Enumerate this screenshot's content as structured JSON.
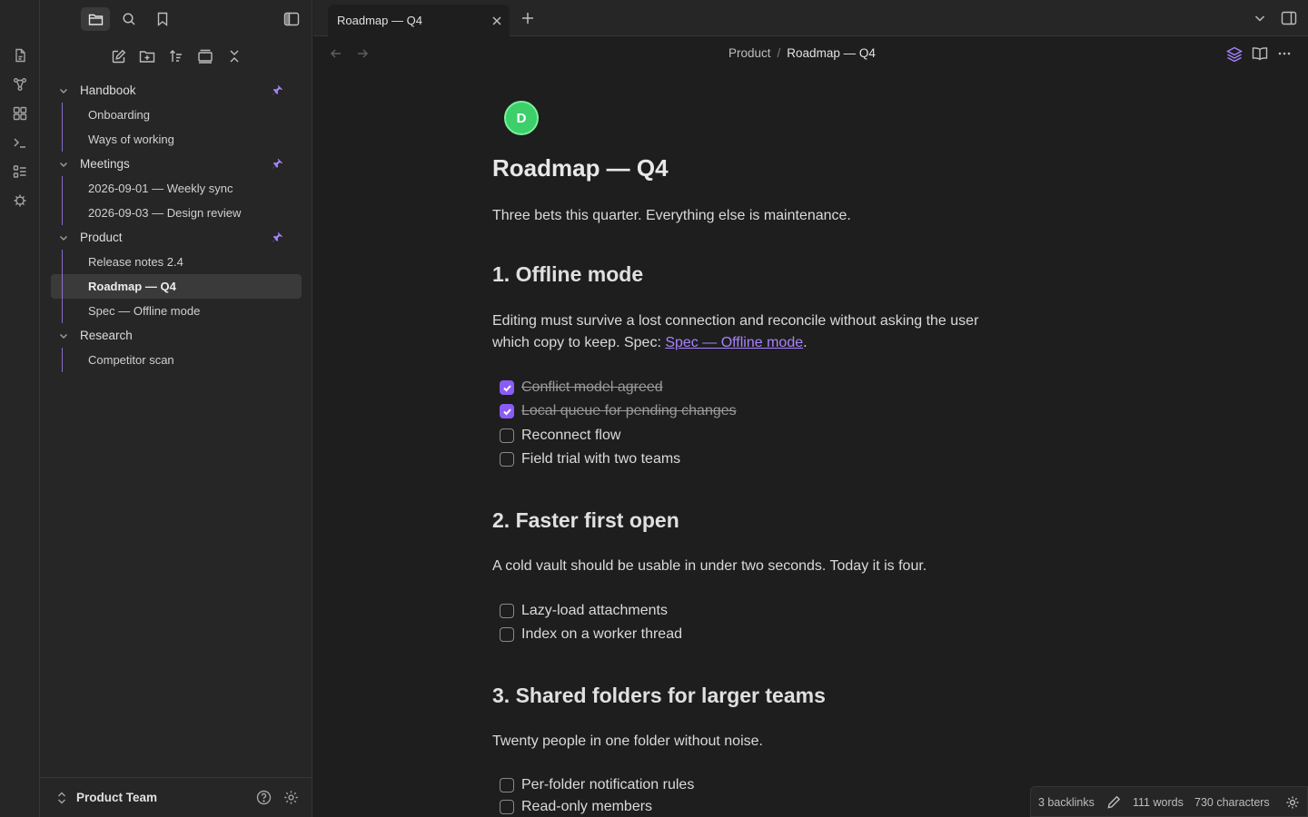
{
  "sidebar": {
    "tree": [
      {
        "label": "Handbook",
        "children": [
          "Onboarding",
          "Ways of working"
        ]
      },
      {
        "label": "Meetings",
        "children": [
          "2026-09-01 — Weekly sync",
          "2026-09-03 — Design review"
        ]
      },
      {
        "label": "Product",
        "children": [
          "Release notes 2.4",
          "Roadmap — Q4",
          "Spec — Offline mode"
        ]
      },
      {
        "label": "Research",
        "children": [
          "Competitor scan"
        ]
      }
    ],
    "vault_name": "Product Team"
  },
  "tabbar": {
    "active_tab": "Roadmap — Q4"
  },
  "header": {
    "breadcrumb_parent": "Product",
    "breadcrumb_sep": "/",
    "breadcrumb_current": "Roadmap — Q4"
  },
  "note": {
    "avatar_letter": "D",
    "title": "Roadmap — Q4",
    "intro": "Three bets this quarter. Everything else is maintenance.",
    "s1_heading": "1. Offline mode",
    "s1_text": "Editing must survive a lost connection and reconcile without asking the user which copy to keep. Spec: ",
    "s1_link": "Spec — Offline mode",
    "s1_after": ".",
    "s1_tasks": [
      "Conflict model agreed",
      "Local queue for pending changes",
      "Reconnect flow",
      "Field trial with two teams"
    ],
    "s2_heading": "2. Faster first open",
    "s2_text": "A cold vault should be usable in under two seconds. Today it is four.",
    "s2_tasks": [
      "Lazy-load attachments",
      "Index on a worker thread"
    ],
    "s3_heading": "3. Shared folders for larger teams",
    "s3_text": "Twenty people in one folder without noise.",
    "s3_tasks": [
      "Per-folder notification rules",
      "Read-only members"
    ]
  },
  "status": {
    "backlinks": "3 backlinks",
    "words": "111 words",
    "characters": "730 characters"
  },
  "colors": {
    "accent": "#a882ff",
    "avatar": "#3ccf6a",
    "background": "#1e1e1e",
    "sidebar": "#262626"
  }
}
